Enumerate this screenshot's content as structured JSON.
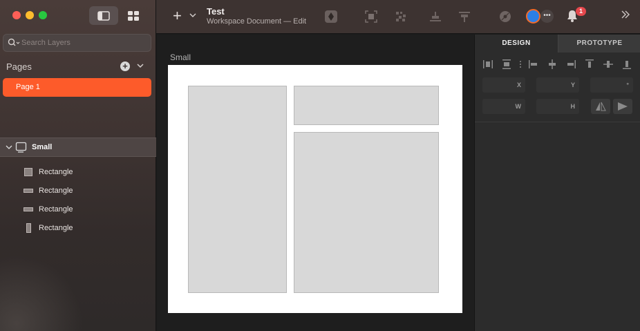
{
  "toolbar": {
    "title": "Test",
    "subtitle": "Workspace Document — Edit",
    "notifications_count": "1",
    "avatar_more": "•••"
  },
  "sidebar": {
    "search_placeholder": "Search Layers",
    "pages_label": "Pages",
    "pages": [
      "Page 1"
    ],
    "artboard_name": "Small",
    "layers": [
      {
        "label": "Rectangle",
        "icon": "rectangle-square-icon"
      },
      {
        "label": "Rectangle",
        "icon": "rectangle-wide-icon"
      },
      {
        "label": "Rectangle",
        "icon": "rectangle-wide-icon"
      },
      {
        "label": "Rectangle",
        "icon": "rectangle-tall-icon"
      }
    ]
  },
  "canvas": {
    "artboard_label": "Small"
  },
  "inspector": {
    "tabs": [
      "DESIGN",
      "PROTOTYPE"
    ],
    "fields": {
      "x": "X",
      "y": "Y",
      "rotation": "°",
      "w": "W",
      "h": "H"
    }
  },
  "colors": {
    "accent": "#fd5b2a",
    "sidebar_bg": "#3f3432",
    "canvas_bg": "#1e1e1e",
    "artboard_bg": "#ffffff",
    "shape_fill": "#d8d8d8",
    "badge": "#e5484d"
  }
}
